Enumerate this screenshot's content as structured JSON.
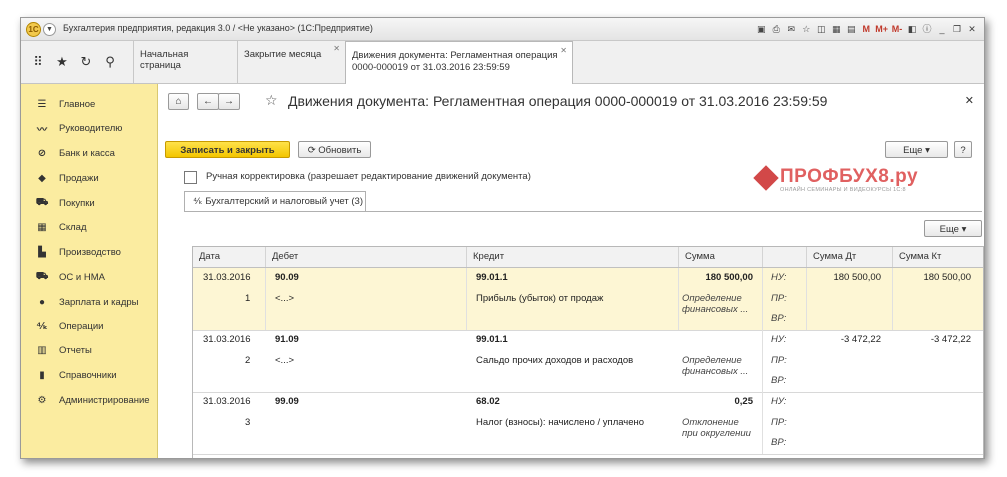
{
  "window": {
    "title": "Бухгалтерия предприятия, редакция 3.0 / <Не указано>  (1С:Предприятие)"
  },
  "titlebar_tools": [
    "M",
    "M+",
    "M-"
  ],
  "tabs": [
    {
      "label": "Начальная страница"
    },
    {
      "label": "Закрытие месяца"
    },
    {
      "label": "Движения документа: Регламентная операция 0000-000019 от 31.03.2016 23:59:59"
    }
  ],
  "sidebar": {
    "items": [
      {
        "label": "Главное",
        "icon": "menu-icon"
      },
      {
        "label": "Руководителю",
        "icon": "chart-trend-icon"
      },
      {
        "label": "Банк и касса",
        "icon": "bank-icon"
      },
      {
        "label": "Продажи",
        "icon": "bag-icon"
      },
      {
        "label": "Покупки",
        "icon": "cart-icon"
      },
      {
        "label": "Склад",
        "icon": "warehouse-icon"
      },
      {
        "label": "Производство",
        "icon": "factory-icon"
      },
      {
        "label": "ОС и НМА",
        "icon": "truck-icon"
      },
      {
        "label": "Зарплата и кадры",
        "icon": "person-icon"
      },
      {
        "label": "Операции",
        "icon": "operations-icon"
      },
      {
        "label": "Отчеты",
        "icon": "bar-chart-icon"
      },
      {
        "label": "Справочники",
        "icon": "book-icon"
      },
      {
        "label": "Администрирование",
        "icon": "gear-icon"
      }
    ]
  },
  "document": {
    "title": "Движения документа: Регламентная операция 0000-000019 от 31.03.2016 23:59:59",
    "save_close_label": "Записать и закрыть",
    "refresh_label": "Обновить",
    "more_label": "Еще",
    "help_label": "?",
    "manual_label": "Ручная корректировка (разрешает редактирование движений документа)",
    "subtab_label": "Бухгалтерский и налоговый учет (3)",
    "table_more_label": "Еще"
  },
  "watermark": {
    "text": "ПРОФБУХ8.ру",
    "sub": "ОНЛАЙН СЕМИНАРЫ И ВИДЕОКУРСЫ 1С:8"
  },
  "table": {
    "columns": [
      "Дата",
      "Дебет",
      "Кредит",
      "Сумма",
      "",
      "Сумма Дт",
      "Сумма Кт"
    ],
    "rows": [
      {
        "date": "31.03.2016",
        "num": "1",
        "debit": "90.09",
        "debit_sub": "<...>",
        "credit": "99.01.1",
        "credit_sub": "Прибыль (убыток) от продаж",
        "sum": "180 500,00",
        "comment1": "Определение",
        "comment2": "финансовых ...",
        "nu": "НУ:",
        "pr": "ПР:",
        "vr": "ВР:",
        "sum_dt": "180 500,00",
        "sum_kt": "180 500,00"
      },
      {
        "date": "31.03.2016",
        "num": "2",
        "debit": "91.09",
        "debit_sub": "<...>",
        "credit": "99.01.1",
        "credit_sub": "Сальдо прочих доходов и расходов",
        "sum": "",
        "comment1": "Определение",
        "comment2": "финансовых ...",
        "nu": "НУ:",
        "pr": "ПР:",
        "vr": "ВР:",
        "sum_dt": "-3 472,22",
        "sum_kt": "-3 472,22"
      },
      {
        "date": "31.03.2016",
        "num": "3",
        "debit": "99.09",
        "debit_sub": "",
        "credit": "68.02",
        "credit_sub": "Налог (взносы): начислено / уплачено",
        "sum": "0,25",
        "comment1": "Отклонение",
        "comment2": "при округлении",
        "nu": "НУ:",
        "pr": "ПР:",
        "vr": "ВР:",
        "sum_dt": "",
        "sum_kt": ""
      }
    ]
  }
}
